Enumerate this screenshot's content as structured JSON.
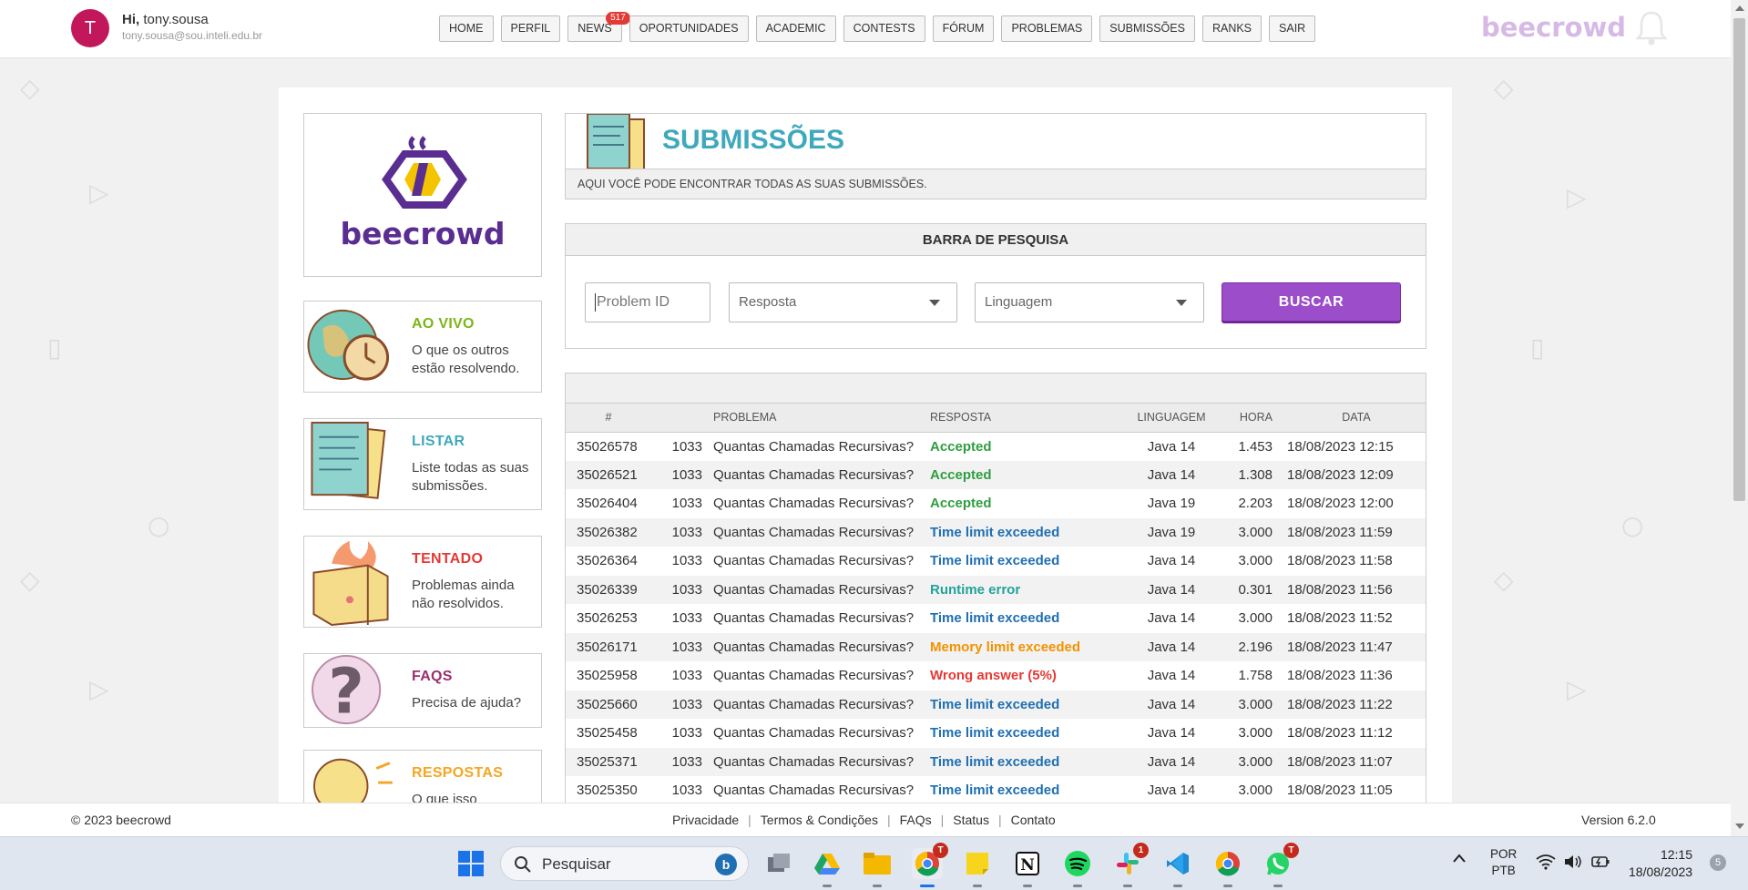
{
  "user": {
    "initial": "T",
    "hi": "Hi,",
    "name": "tony.sousa",
    "email": "tony.sousa@sou.inteli.edu.br"
  },
  "nav": {
    "items": [
      "HOME",
      "PERFIL",
      "NEWS",
      "OPORTUNIDADES",
      "ACADEMIC",
      "CONTESTS",
      "FÓRUM",
      "PROBLEMAS",
      "SUBMISSÕES",
      "RANKS",
      "SAIR"
    ],
    "news_badge": "517",
    "brand": "beecrowd"
  },
  "logo": {
    "text": "beecrowd"
  },
  "sidebar": [
    {
      "title": "AO VIVO",
      "desc": "O que os outros estão resolvendo.",
      "color": "#7cb518"
    },
    {
      "title": "LISTAR",
      "desc": "Liste todas as suas submissões.",
      "color": "#3ea8bd"
    },
    {
      "title": "TENTADO",
      "desc": "Problemas ainda não resolvidos.",
      "color": "#e53935"
    },
    {
      "title": "FAQS",
      "desc": "Precisa de ajuda?",
      "color": "#9c2f6e"
    },
    {
      "title": "RESPOSTAS",
      "desc": "O que isso",
      "color": "#f5a623"
    }
  ],
  "header": {
    "title": "SUBMISSÕES",
    "description": "AQUI VOCÊ PODE ENCONTRAR TODAS AS SUAS SUBMISSÕES."
  },
  "search": {
    "title": "BARRA DE PESQUISA",
    "problem_placeholder": "Problem ID",
    "resposta": "Resposta",
    "linguagem": "Linguagem",
    "button": "BUSCAR"
  },
  "table": {
    "headers": [
      "#",
      "",
      "PROBLEMA",
      "RESPOSTA",
      "LINGUAGEM",
      "HORA",
      "DATA"
    ],
    "rows": [
      {
        "id": "35026578",
        "num": "1033",
        "problem": "Quantas Chamadas Recursivas?",
        "answer": "Accepted",
        "status": "ok",
        "lang": "Java 14",
        "time": "1.453",
        "date": "18/08/2023 12:15"
      },
      {
        "id": "35026521",
        "num": "1033",
        "problem": "Quantas Chamadas Recursivas?",
        "answer": "Accepted",
        "status": "ok",
        "lang": "Java 14",
        "time": "1.308",
        "date": "18/08/2023 12:09"
      },
      {
        "id": "35026404",
        "num": "1033",
        "problem": "Quantas Chamadas Recursivas?",
        "answer": "Accepted",
        "status": "ok",
        "lang": "Java 19",
        "time": "2.203",
        "date": "18/08/2023 12:00"
      },
      {
        "id": "35026382",
        "num": "1033",
        "problem": "Quantas Chamadas Recursivas?",
        "answer": "Time limit exceeded",
        "status": "tle",
        "lang": "Java 19",
        "time": "3.000",
        "date": "18/08/2023 11:59"
      },
      {
        "id": "35026364",
        "num": "1033",
        "problem": "Quantas Chamadas Recursivas?",
        "answer": "Time limit exceeded",
        "status": "tle",
        "lang": "Java 14",
        "time": "3.000",
        "date": "18/08/2023 11:58"
      },
      {
        "id": "35026339",
        "num": "1033",
        "problem": "Quantas Chamadas Recursivas?",
        "answer": "Runtime error",
        "status": "rte",
        "lang": "Java 14",
        "time": "0.301",
        "date": "18/08/2023 11:56"
      },
      {
        "id": "35026253",
        "num": "1033",
        "problem": "Quantas Chamadas Recursivas?",
        "answer": "Time limit exceeded",
        "status": "tle",
        "lang": "Java 14",
        "time": "3.000",
        "date": "18/08/2023 11:52"
      },
      {
        "id": "35026171",
        "num": "1033",
        "problem": "Quantas Chamadas Recursivas?",
        "answer": "Memory limit exceeded",
        "status": "mle",
        "lang": "Java 14",
        "time": "2.196",
        "date": "18/08/2023 11:47"
      },
      {
        "id": "35025958",
        "num": "1033",
        "problem": "Quantas Chamadas Recursivas?",
        "answer": "Wrong answer (5%)",
        "status": "wa",
        "lang": "Java 14",
        "time": "1.758",
        "date": "18/08/2023 11:36"
      },
      {
        "id": "35025660",
        "num": "1033",
        "problem": "Quantas Chamadas Recursivas?",
        "answer": "Time limit exceeded",
        "status": "tle",
        "lang": "Java 14",
        "time": "3.000",
        "date": "18/08/2023 11:22"
      },
      {
        "id": "35025458",
        "num": "1033",
        "problem": "Quantas Chamadas Recursivas?",
        "answer": "Time limit exceeded",
        "status": "tle",
        "lang": "Java 14",
        "time": "3.000",
        "date": "18/08/2023 11:12"
      },
      {
        "id": "35025371",
        "num": "1033",
        "problem": "Quantas Chamadas Recursivas?",
        "answer": "Time limit exceeded",
        "status": "tle",
        "lang": "Java 14",
        "time": "3.000",
        "date": "18/08/2023 11:07"
      },
      {
        "id": "35025350",
        "num": "1033",
        "problem": "Quantas Chamadas Recursivas?",
        "answer": "Time limit exceeded",
        "status": "tle",
        "lang": "Java 14",
        "time": "3.000",
        "date": "18/08/2023 11:05"
      }
    ],
    "status_colors": {
      "ok": "#2e9e3f",
      "tle": "#1f6fb2",
      "rte": "#22a39a",
      "mle": "#f39200",
      "wa": "#e53935"
    }
  },
  "footer": {
    "copyright": "© 2023 beecrowd",
    "links": [
      "Privacidade",
      "Termos & Condições",
      "FAQs",
      "Status",
      "Contato"
    ],
    "version": "Version 6.2.0"
  },
  "taskbar": {
    "search_placeholder": "Pesquisar",
    "lang_line1": "POR",
    "lang_line2": "PTB",
    "time": "12:15",
    "date": "18/08/2023",
    "notification_count": "5",
    "chrome_badge": "T",
    "slack_badge": "1",
    "whatsapp_badge": "T"
  }
}
